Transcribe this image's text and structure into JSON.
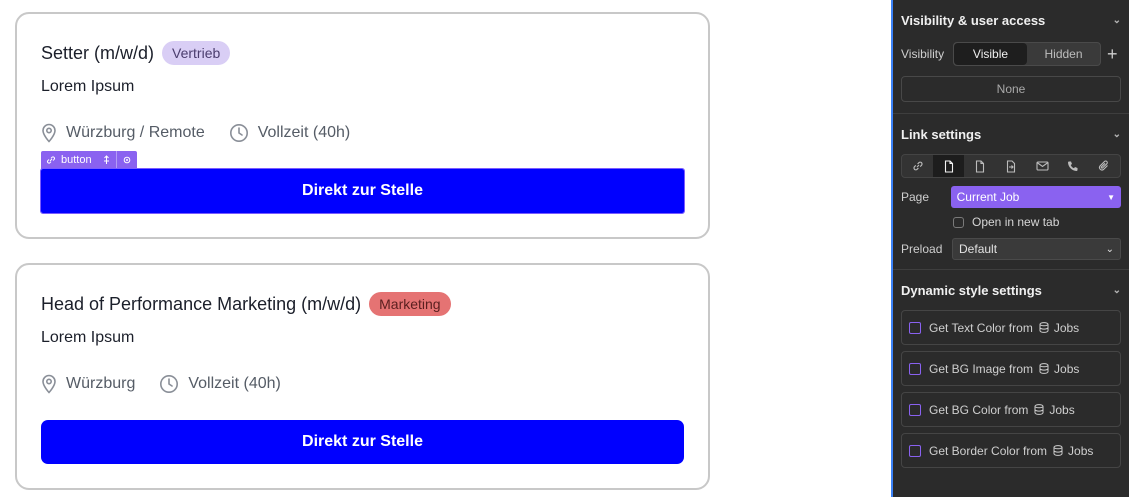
{
  "cards": [
    {
      "title": "Setter (m/w/d)",
      "tag": "Vertrieb",
      "subtitle": "Lorem Ipsum",
      "location": "Würzburg / Remote",
      "employment": "Vollzeit (40h)",
      "cta": "Direkt zur Stelle"
    },
    {
      "title": "Head of Performance Marketing (m/w/d)",
      "tag": "Marketing",
      "subtitle": "Lorem Ipsum",
      "location": "Würzburg",
      "employment": "Vollzeit (40h)",
      "cta": "Direkt zur Stelle"
    }
  ],
  "selection_tag": {
    "label": "button"
  },
  "panel": {
    "visibility": {
      "heading": "Visibility & user access",
      "label": "Visibility",
      "options": [
        "Visible",
        "Hidden"
      ],
      "selected": "Visible",
      "conditions_value": "None"
    },
    "link": {
      "heading": "Link settings",
      "page_label": "Page",
      "page_value": "Current Job",
      "new_tab_label": "Open in new tab",
      "preload_label": "Preload",
      "preload_value": "Default",
      "icons": [
        "link-icon",
        "page-icon",
        "file-icon",
        "section-icon",
        "email-icon",
        "phone-icon",
        "attachment-icon"
      ]
    },
    "dynamic": {
      "heading": "Dynamic style settings",
      "items": [
        {
          "label": "Get Text Color from",
          "source": "Jobs"
        },
        {
          "label": "Get BG Image from",
          "source": "Jobs"
        },
        {
          "label": "Get BG Color from",
          "source": "Jobs"
        },
        {
          "label": "Get Border Color from",
          "source": "Jobs"
        }
      ]
    }
  },
  "colors": {
    "cta": "#0000ff",
    "tag_vertrieb": "#d9cef5",
    "tag_marketing": "#e57373",
    "accent": "#8a62f0",
    "panel_bg": "#2b2b2b"
  }
}
